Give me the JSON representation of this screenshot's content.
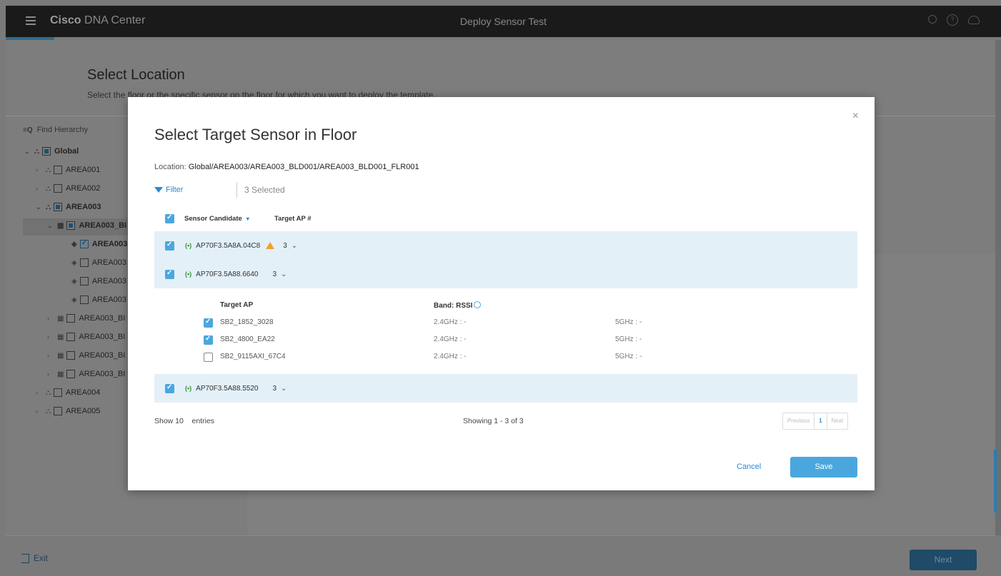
{
  "app": {
    "brand_bold": "Cisco",
    "brand_rest": " DNA Center",
    "page_title": "Deploy Sensor Test"
  },
  "background": {
    "title": "Select Location",
    "subtitle": "Select the floor or the specific sensor on the floor for which you want to deploy the template.",
    "find_placeholder": "Find Hierarchy",
    "tree": [
      "Global",
      "AREA001",
      "AREA002",
      "AREA003",
      "AREA003_BI",
      "AREA003",
      "AREA003",
      "AREA003",
      "AREA003",
      "AREA003_BI",
      "AREA003_BI",
      "AREA003_BI",
      "AREA003_BI",
      "AREA004",
      "AREA005"
    ],
    "exit_label": "Exit",
    "next_label": "Next"
  },
  "modal": {
    "title": "Select Target Sensor in Floor",
    "location_label": "Location: ",
    "location_value": "Global/AREA003/AREA003_BLD001/AREA003_BLD001_FLR001",
    "filter_label": "Filter",
    "selected_text": "3 Selected",
    "headers": {
      "sensor_candidate": "Sensor Candidate",
      "target_ap": "Target AP #"
    },
    "rows": [
      {
        "name": "AP70F3.5A8A.04C8",
        "count": "3",
        "warning": true
      },
      {
        "name": "AP70F3.5A88.6640",
        "count": "3",
        "warning": false
      },
      {
        "name": "AP70F3.5A88.5520",
        "count": "3",
        "warning": false
      }
    ],
    "detail": {
      "col_target_ap": "Target AP",
      "col_band": "Band: RSSI",
      "items": [
        {
          "name": "SB2_1852_3028",
          "b24": "2.4GHz : -",
          "b5": "5GHz : -",
          "checked": true
        },
        {
          "name": "SB2_4800_EA22",
          "b24": "2.4GHz : -",
          "b5": "5GHz : -",
          "checked": true
        },
        {
          "name": "SB2_9115AXI_67C4",
          "b24": "2.4GHz : -",
          "b5": "5GHz : -",
          "checked": false
        }
      ]
    },
    "footer": {
      "show": "Show 10",
      "entries": "entries",
      "showing": "Showing 1 - 3 of 3",
      "prev": "Previous",
      "page": "1",
      "next": "Next"
    },
    "cancel_label": "Cancel",
    "save_label": "Save",
    "close_glyph": "×"
  }
}
